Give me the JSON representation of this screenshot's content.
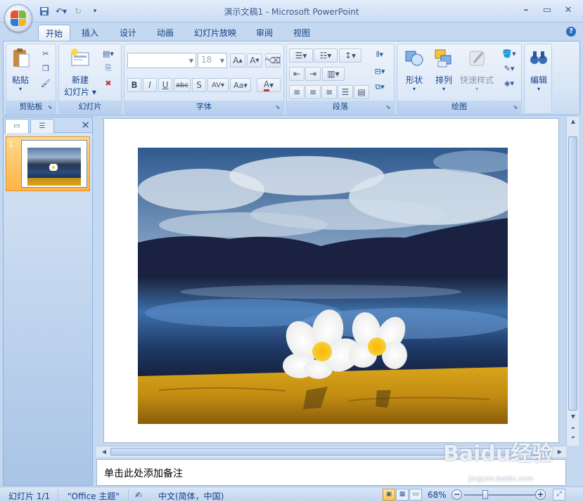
{
  "app": {
    "window_title": "演示文稿1 - Microsoft PowerPoint"
  },
  "tabs": [
    {
      "label": "开始"
    },
    {
      "label": "插入"
    },
    {
      "label": "设计"
    },
    {
      "label": "动画"
    },
    {
      "label": "幻灯片放映"
    },
    {
      "label": "审阅"
    },
    {
      "label": "视图"
    }
  ],
  "ribbon": {
    "clipboard": {
      "group_label": "剪贴板",
      "paste_label": "粘贴"
    },
    "slides": {
      "group_label": "幻灯片",
      "new_slide_line1": "新建",
      "new_slide_line2": "幻灯片"
    },
    "font": {
      "group_label": "字体",
      "font_name": "",
      "font_size": "18"
    },
    "paragraph": {
      "group_label": "段落"
    },
    "drawing": {
      "group_label": "绘图",
      "shapes_label": "形状",
      "arrange_label": "排列",
      "quick_styles_label": "快速样式"
    },
    "editing": {
      "group_label": "编辑"
    }
  },
  "slides_pane": {
    "slides": [
      {
        "number": "1"
      }
    ]
  },
  "notes": {
    "placeholder": "单击此处添加备注"
  },
  "status": {
    "slide_counter": "幻灯片 1/1",
    "theme": "\"Office 主题\"",
    "language": "中文(简体，中国)",
    "zoom": "68%"
  },
  "watermark": {
    "brand": "Baidu经验",
    "sub": "jingyan.baidu.com"
  },
  "colors": {
    "ribbon_bg": "#d9e6f6",
    "accent_orange": "#ffb347",
    "text_blue": "#15428b"
  }
}
